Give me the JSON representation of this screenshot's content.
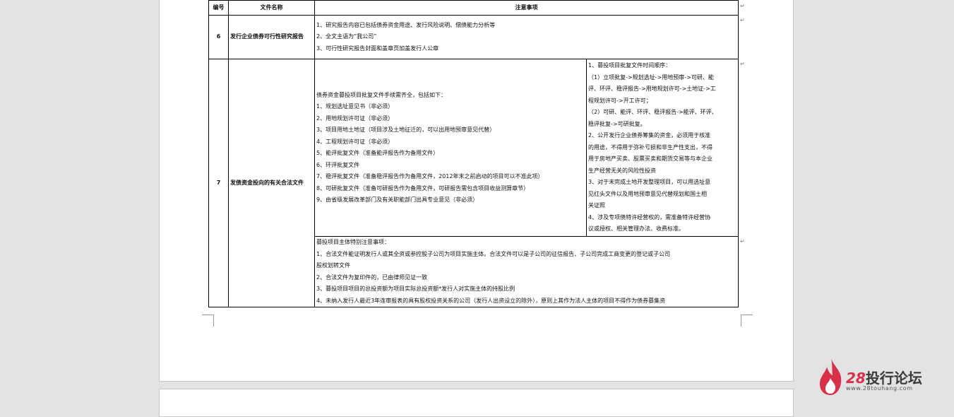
{
  "table": {
    "headers": [
      "编号",
      "文件名称",
      "注意事项"
    ],
    "row6": {
      "num": "6",
      "name": "发行企业债券可行性研究报告",
      "notes": [
        "1、研究报告内容已包括债券资金用途、发行风险说明、偿债能力分析等",
        "2、全文主语为“我公司”",
        "3、可行性研究报告封面和盖章页加盖发行人公章"
      ]
    },
    "row7": {
      "num": "7",
      "name": "发债资金投向的有关合法文件",
      "left_notes": [
        "债券资金募投项目批复文件手续需齐全，包括如下：",
        "1、规划选址意见书（非必须）",
        "2、用地规划许可证（非必须）",
        "3、项目用地土地证（项目涉及土地征迁的，可以出用地预审意见代替）",
        "4、工程规划许可证（非必须）",
        "5、能评批复文件（准备能评报告作为备用文件）",
        "6、环评批复文件",
        "7、稳评批复文件（准备稳评报告作为备用文件，2012年末之前启动的项目可以不准此项）",
        "8、可研批复文件（准备可研报告作为备用文件，可研报告需包含项目收益测算章节）",
        "9、由省级发展改革部门及有关职能部门出具专业意见（非必须）"
      ],
      "right_notes": [
        "1、募投项目批复文件时间顺序：",
        "（1）立项批复->规划选址->用地预审->可研、能",
        "评、环评、稳评报告->用地规划许可->土地证->工",
        "程规划许可->开工许可；",
        "（2）可研、能评、环评、稳评报告->能评、环评、",
        "稳评批复->可研批复。",
        "2、公开发行企业债券筹集的资金，必须用于核准",
        "的用途，不得用于弥补亏损和非生产性支出，不得",
        "用于房地产买卖、股票买卖和期货交易等与本企业",
        "生产经营无关的风险性投资",
        "3、对于未完成土地开发整理项目，可以用选址意",
        "见红头文件以及用地预审意见代替规划和国土相",
        "关证照",
        "4、涉及专项债特许经营权的，需准备特许经营协",
        "议或授权、相关管理办法、收费标准。"
      ],
      "bottom_notes": [
        "募投项目主体特别注意事项：",
        "1、合法文件能证明发行人或其全资或参控股子公司为项目实施主体。合法文件可以是子公司的征信报告、子公司完成工商变更的登记或子公司",
        "股权划转文件",
        "2、合法文件为复印件的，已由律师见证一致",
        "3、募投项目项目的总投资额为项目实际总投资额*发行人对实施主体的持股比例",
        "4、未纳入发行人最近3年连审报表的具有股权投资关系的公司（发行人出资设立的除外），原则上其作为法人主体的项目不得作为债券募集资"
      ]
    }
  },
  "logo": {
    "number": "28",
    "name": "投行论坛",
    "url": "www.28touhang.com",
    "brand_color": "#d9304a"
  }
}
